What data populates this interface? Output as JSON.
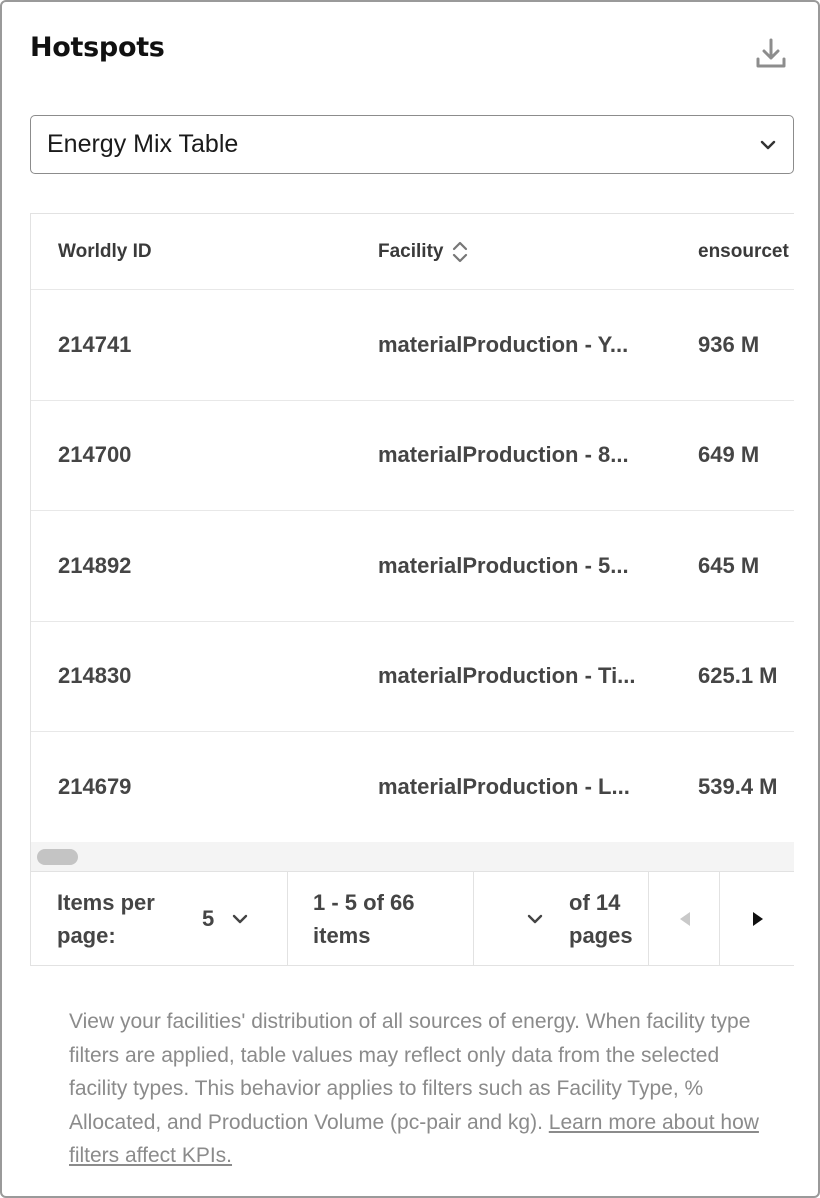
{
  "header": {
    "title": "Hotspots",
    "download_icon": "download-icon"
  },
  "view_select": {
    "selected": "Energy Mix Table",
    "icon": "chevron-down-icon"
  },
  "table": {
    "columns": [
      "Worldly ID",
      "Facility",
      "ensourcet"
    ],
    "rows": [
      {
        "id": "214741",
        "facility": "materialProduction - Y...",
        "value": "936 M"
      },
      {
        "id": "214700",
        "facility": "materialProduction - 8...",
        "value": "649 M"
      },
      {
        "id": "214892",
        "facility": "materialProduction - 5...",
        "value": "645 M"
      },
      {
        "id": "214830",
        "facility": "materialProduction - Ti...",
        "value": "625.1 M"
      },
      {
        "id": "214679",
        "facility": "materialProduction - L...",
        "value": "539.4 M"
      }
    ]
  },
  "pagination": {
    "items_per_page_label": "Items per page:",
    "items_per_page_value": "5",
    "range_label": "1 - 5 of 66 items",
    "of_pages_label": "of 14 pages"
  },
  "description": {
    "text": "View your facilities' distribution of all sources of energy. When facility type filters are applied, table values may reflect only data from the selected facility types. This behavior applies to filters such as Facility Type, % Allocated, and Production Volume (pc-pair and kg). ",
    "link": "Learn more about how filters affect KPIs."
  },
  "colors": {
    "border": "#9a9a9a",
    "text": "#454545",
    "muted": "#8b8b8b"
  }
}
